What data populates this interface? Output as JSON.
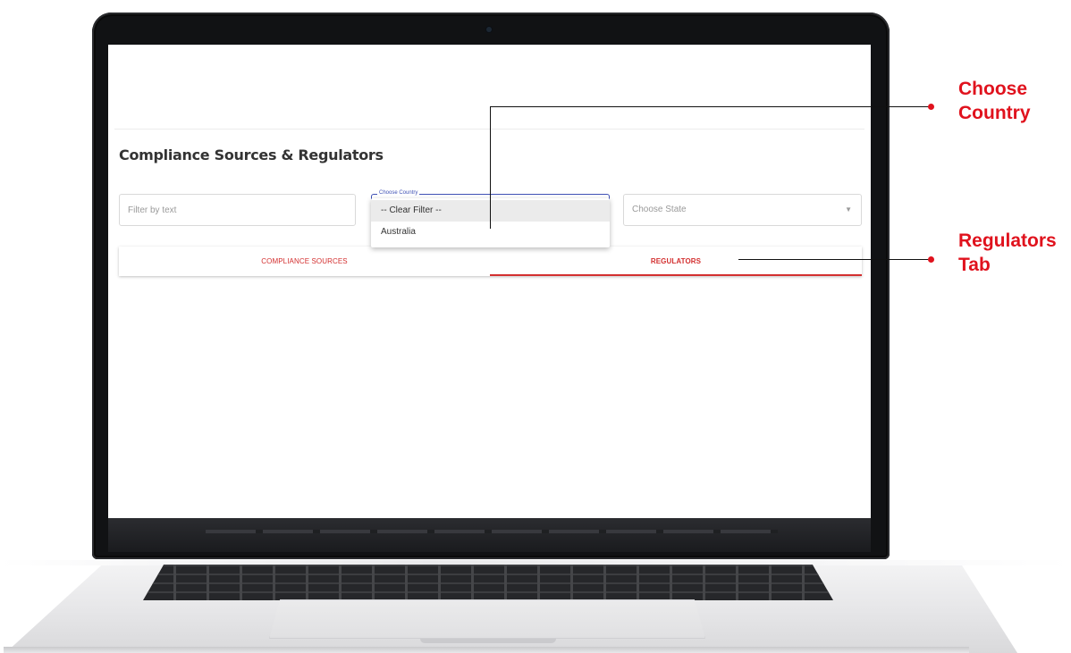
{
  "app": {
    "page_title": "Compliance Sources & Regulators",
    "filter_text": {
      "placeholder": "Filter by text",
      "value": ""
    },
    "country_select": {
      "floating_label": "Choose Country",
      "options": [
        "-- Clear Filter --",
        "Australia"
      ],
      "highlighted_option": "-- Clear Filter --"
    },
    "state_select": {
      "placeholder": "Choose State",
      "caret_icon": "caret-down-icon"
    },
    "tabs": [
      {
        "label": "COMPLIANCE SOURCES",
        "selected": false
      },
      {
        "label": "REGULATORS",
        "selected": true
      }
    ],
    "accent_color": "#d32f2f",
    "focus_color": "#3f51b5"
  },
  "annotations": {
    "country": {
      "line1": "Choose",
      "line2": "Country"
    },
    "regulators": {
      "line1": "Regulators",
      "line2": "Tab"
    },
    "color": "#e0121d"
  }
}
